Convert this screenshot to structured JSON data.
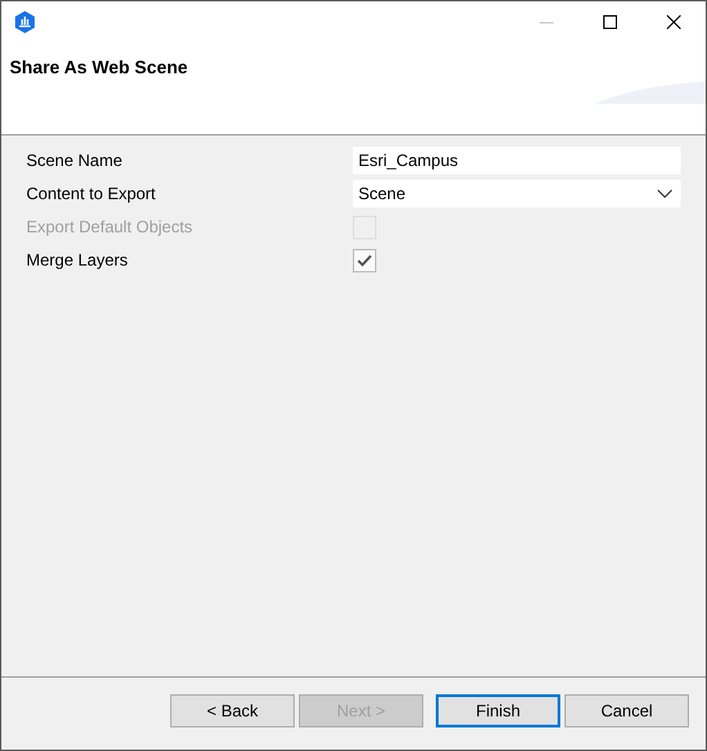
{
  "header": {
    "title": "Share As Web Scene"
  },
  "fields": [
    {
      "label": "Scene Name",
      "kind": "text",
      "value": "Esri_Campus"
    },
    {
      "label": "Content to Export",
      "kind": "combo",
      "value": "Scene"
    },
    {
      "label": "Export Default Objects",
      "kind": "checkbox",
      "checked": false,
      "disabled": true
    },
    {
      "label": "Merge Layers",
      "kind": "checkbox",
      "checked": true,
      "disabled": false
    }
  ],
  "buttons": [
    {
      "label": "< Back",
      "disabled": false,
      "focused": false
    },
    {
      "label": "Next >",
      "disabled": true,
      "focused": false
    },
    {
      "label": "Finish",
      "disabled": false,
      "focused": true
    },
    {
      "label": "Cancel",
      "disabled": false,
      "focused": false
    }
  ]
}
